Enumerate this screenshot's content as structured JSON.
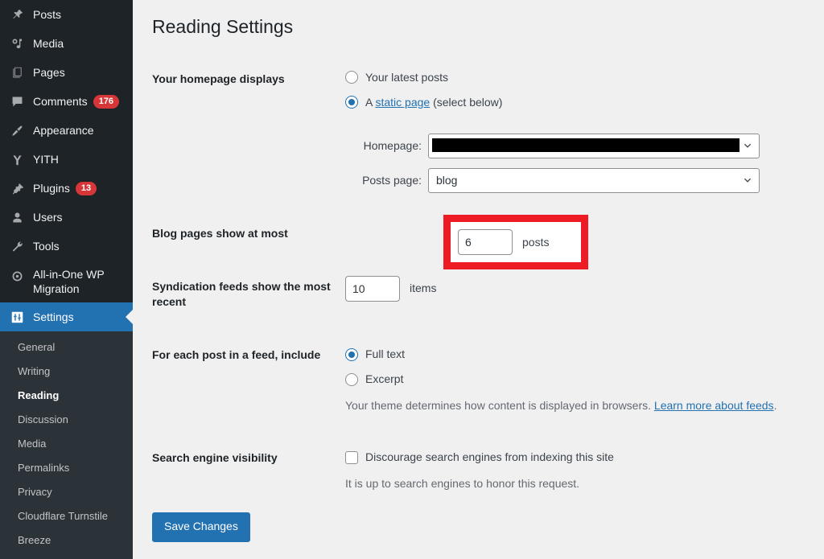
{
  "sidebar": {
    "items": [
      {
        "label": "Posts",
        "icon": "pushpin-icon",
        "badge": null,
        "current": false
      },
      {
        "label": "Media",
        "icon": "media-icon",
        "badge": null,
        "current": false
      },
      {
        "label": "Pages",
        "icon": "pages-icon",
        "badge": null,
        "current": false
      },
      {
        "label": "Comments",
        "icon": "comment-icon",
        "badge": "176",
        "current": false
      },
      {
        "label": "Appearance",
        "icon": "paintbrush-icon",
        "badge": null,
        "current": false
      },
      {
        "label": "YITH",
        "icon": "yith-icon",
        "badge": null,
        "current": false
      },
      {
        "label": "Plugins",
        "icon": "plug-icon",
        "badge": "13",
        "current": false
      },
      {
        "label": "Users",
        "icon": "user-icon",
        "badge": null,
        "current": false
      },
      {
        "label": "Tools",
        "icon": "wrench-icon",
        "badge": null,
        "current": false
      },
      {
        "label": "All-in-One WP Migration",
        "icon": "migration-icon",
        "badge": null,
        "current": false
      },
      {
        "label": "Settings",
        "icon": "settings-sliders-icon",
        "badge": null,
        "current": true
      }
    ],
    "submenu": [
      {
        "label": "General",
        "current": false
      },
      {
        "label": "Writing",
        "current": false
      },
      {
        "label": "Reading",
        "current": true
      },
      {
        "label": "Discussion",
        "current": false
      },
      {
        "label": "Media",
        "current": false
      },
      {
        "label": "Permalinks",
        "current": false
      },
      {
        "label": "Privacy",
        "current": false
      },
      {
        "label": "Cloudflare Turnstile",
        "current": false
      },
      {
        "label": "Breeze",
        "current": false
      }
    ]
  },
  "page": {
    "title": "Reading Settings"
  },
  "homepage_displays": {
    "label": "Your homepage displays",
    "option_latest": "Your latest posts",
    "option_static_prefix": "A ",
    "option_static_link": "static page",
    "option_static_suffix": " (select below)",
    "homepage_label": "Homepage:",
    "homepage_value": "",
    "posts_page_label": "Posts page:",
    "posts_page_value": "blog"
  },
  "blog_pages": {
    "label": "Blog pages show at most",
    "value": "6",
    "unit": "posts"
  },
  "syndication": {
    "label": "Syndication feeds show the most recent",
    "value": "10",
    "unit": "items"
  },
  "feed_include": {
    "label": "For each post in a feed, include",
    "option_full": "Full text",
    "option_excerpt": "Excerpt",
    "description_prefix": "Your theme determines how content is displayed in browsers. ",
    "description_link": "Learn more about feeds",
    "description_suffix": "."
  },
  "search_visibility": {
    "label": "Search engine visibility",
    "checkbox_label": "Discourage search engines from indexing this site",
    "description": "It is up to search engines to honor this request."
  },
  "actions": {
    "save_label": "Save Changes"
  },
  "colors": {
    "sidebar_bg": "#1d2327",
    "submenu_bg": "#2c3338",
    "accent": "#2271b1",
    "badge": "#d63638",
    "annotation": "#ed1c24",
    "main_bg": "#f0f0f1"
  }
}
